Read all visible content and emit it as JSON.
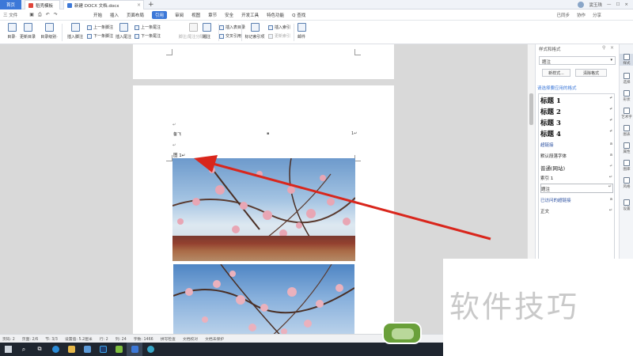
{
  "titlebar": {
    "tabs": [
      {
        "label": "首页"
      },
      {
        "label": "稻壳模板"
      },
      {
        "label": "新建 DOCX 文档.docx"
      }
    ],
    "new_tab": "+",
    "user_name": "窦玉珠"
  },
  "menubar": {
    "file_label": "三 文件",
    "items": [
      "开始",
      "插入",
      "页面布局",
      "引用",
      "审阅",
      "视图",
      "章节",
      "安全",
      "开发工具",
      "特色功能"
    ],
    "active_item": "引用",
    "search_label": "Q 查找",
    "sync_label": "已同步",
    "collab_label": "协作",
    "share_label": "分享"
  },
  "ribbon": {
    "toc_label": "目录·",
    "update_toc_label": "更新目录",
    "toc_level_label": "目录级别·",
    "insert_footnote_label": "插入脚注",
    "prev_footnote_label": "上一条脚注",
    "next_footnote_label": "下一条脚注",
    "insert_endnote_label": "插入尾注",
    "prev_endnote_label": "上一条尾注",
    "next_endnote_label": "下一条尾注",
    "footnote_endnote_sep_label": "脚注/尾注分隔线",
    "caption_label": "题注",
    "insert_table_of_figures_label": "插入表目录",
    "cross_reference_label": "交叉引用",
    "mark_index_label": "标记索引项",
    "insert_index_label": "插入索引",
    "update_index_label": "更新索引",
    "mail_label": "邮件"
  },
  "document": {
    "header_left": "备飞",
    "header_right": "1↵",
    "caption_text": "图 1↵",
    "para_mark": "↵"
  },
  "panel": {
    "title": "样式和格式",
    "current_style": "题注",
    "new_style_label": "新样式...",
    "clear_format_label": "清除格式",
    "apply_label": "请选择要应用的格式",
    "styles": [
      {
        "label": "标题 1",
        "kind": "heading"
      },
      {
        "label": "标题 2",
        "kind": "heading"
      },
      {
        "label": "标题 3",
        "kind": "heading"
      },
      {
        "label": "标题 4",
        "kind": "heading"
      },
      {
        "label": "超链接",
        "kind": "link"
      },
      {
        "label": "默认段落字体",
        "kind": "plain"
      },
      {
        "label": "普通(网站)",
        "kind": "plain"
      },
      {
        "label": "索引 1",
        "kind": "plain"
      },
      {
        "label": "题注",
        "kind": "selected"
      },
      {
        "label": "已访问的超链接",
        "kind": "link"
      },
      {
        "label": "正文",
        "kind": "plain"
      }
    ],
    "marks": [
      "↵",
      "↵",
      "↵",
      "↵",
      "a",
      "a",
      "↵",
      "↵",
      "↵",
      "a",
      "↵"
    ]
  },
  "right_tools": [
    {
      "label": "样式"
    },
    {
      "label": "选择"
    },
    {
      "label": "形状"
    },
    {
      "label": "艺术字"
    },
    {
      "label": "图表"
    },
    {
      "label": "属性"
    },
    {
      "label": "图库"
    },
    {
      "label": "风格"
    },
    {
      "label": "设置"
    }
  ],
  "statusbar": {
    "page_num": "页码: 2",
    "pages": "页面: 2/6",
    "section": "节: 3/3",
    "set_value": "设置值: 5.2厘米",
    "row": "行: 2",
    "col": "列: 24",
    "word_count": "字数: 1466",
    "spell_check": "拼写检查",
    "doc_proof": "文档校对",
    "unprotected": "文档未保护"
  },
  "watermark_text": "软件技巧",
  "colors": {
    "accent": "#3c78d8",
    "arrow": "#d9261c",
    "taskbar": "#1f2630"
  }
}
